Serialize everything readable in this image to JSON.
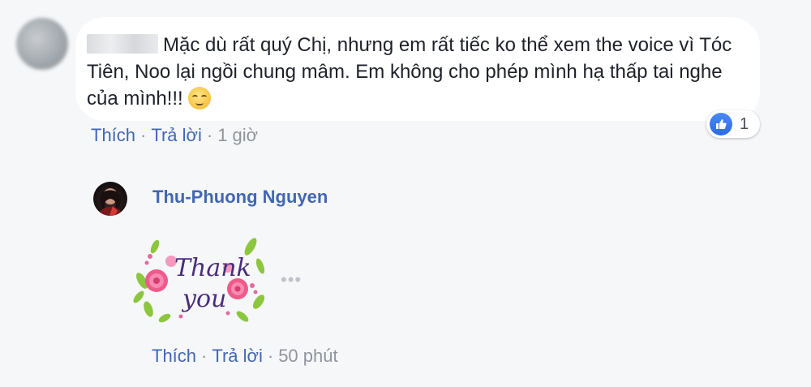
{
  "comment": {
    "text": "Mặc dù rất quý Chị, nhưng em rất tiếc ko thể xem the voice vì Tóc Tiên, Noo lại ngồi chung mâm. Em không cho phép mình hạ thấp tai nghe của mình!!!",
    "emoji": "relieved-face-emoji",
    "reaction": {
      "icon": "like-icon",
      "count": "1"
    },
    "actions": {
      "like": "Thích",
      "reply": "Trả lời",
      "time": "1 giờ",
      "separator": "·"
    }
  },
  "reply": {
    "author": "Thu-Phuong Nguyen",
    "sticker": {
      "icon": "thank-you-sticker",
      "text_line1": "Thank",
      "text_line2": "you"
    },
    "more": "•••",
    "actions": {
      "like": "Thích",
      "reply": "Trả lời",
      "time": "50 phút",
      "separator": "·"
    }
  },
  "colors": {
    "link": "#4267b2",
    "meta": "#90949c",
    "background": "#f6f7f9",
    "bubble": "#ffffff"
  }
}
